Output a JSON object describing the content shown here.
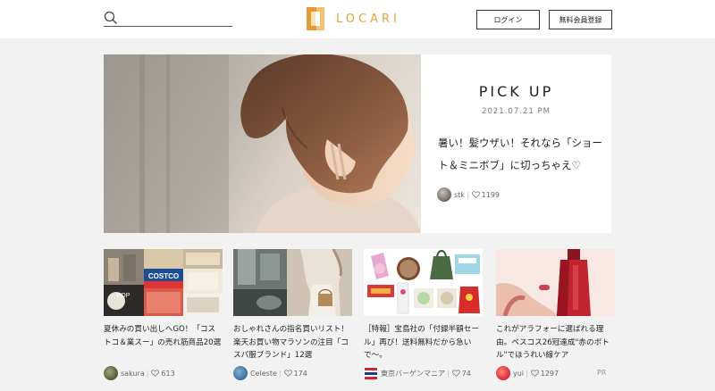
{
  "header": {
    "search_placeholder": "",
    "logo_text": "LOCARI",
    "login_label": "ログイン",
    "register_label": "無料会員登録"
  },
  "hero": {
    "heading": "PICK UP",
    "date": "2021.07.21 PM",
    "title": "暑い！髪ウザい！それなら「ショート＆ミニボブ」に切っちゃえ♡",
    "author": "stk",
    "likes": "1199",
    "image_icon": "woman-short-hair-photo"
  },
  "cards": [
    {
      "title": "夏休みの買い出しへGO！「コストコ＆業スー」の売れ筋商品20選",
      "author": "sakura",
      "likes": "613",
      "thumb_label": "COSTCO",
      "thumb_label2": "POP",
      "image_icon": "costco-products-photo"
    },
    {
      "title": "おしゃれさんの指名買いリスト！楽天お買い物マラソンの注目「コスパ服ブランド」12選",
      "author": "Celeste",
      "likes": "174",
      "image_icon": "fashion-woman-photo"
    },
    {
      "title": "［特報］宝島社の「付録半額セール」再び！送料無料だから急いで〜。",
      "author": "東京バーゲンマニア",
      "likes": "74",
      "image_icon": "magazine-goods-photo"
    },
    {
      "title": "これがアラフォーに選ばれる理由。ベスコス26冠達成\"赤のボトル\"でほうれい線ケア",
      "author": "yui",
      "likes": "1297",
      "pr": "PR",
      "image_icon": "red-serum-bottle-photo"
    }
  ],
  "colors": {
    "logo": "#e5a243",
    "accent_red": "#c0252f"
  }
}
